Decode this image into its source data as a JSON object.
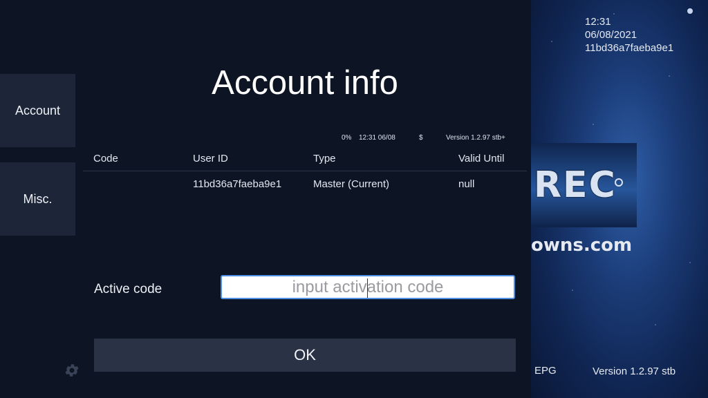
{
  "status_bar": {
    "time": "12:31",
    "date": "06/08/2021",
    "device_id": "11bd36a7faeba9e1"
  },
  "background": {
    "logo_text": "REC",
    "watermark": "techowns.com",
    "epg_label": "EPG",
    "version_label": "Version 1.2.97 stb"
  },
  "sidebar": {
    "items": [
      {
        "label": "Account"
      },
      {
        "label": "Misc."
      }
    ]
  },
  "dialog": {
    "title": "Account info",
    "status": {
      "percent": "0%",
      "datetime": "12:31 06/08",
      "currency": "$",
      "version": "Version 1.2.97 stb+"
    },
    "table": {
      "columns": [
        "Code",
        "User ID",
        "Type",
        "Valid Until"
      ],
      "rows": [
        {
          "code": "",
          "user_id": "11bd36a7faeba9e1",
          "type": "Master (Current)",
          "valid_until": "null"
        }
      ]
    },
    "active_code": {
      "label": "Active code",
      "value": "",
      "placeholder": "input activation code"
    },
    "ok_label": "OK"
  },
  "icons": {
    "settings": "gear-icon"
  },
  "colors": {
    "dialog_bg": "#0d1525",
    "sidebar_item_bg": "#1d2638",
    "input_focus_border": "#4d8fe3",
    "button_bg": "#2a3345"
  }
}
